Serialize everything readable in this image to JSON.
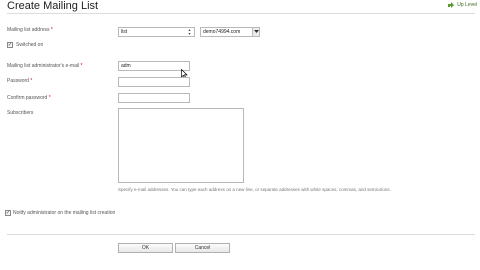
{
  "header": {
    "title": "Create Mailing List",
    "up_level": "Up Level"
  },
  "form": {
    "list_address": {
      "label": "Mailing list address",
      "req": "*",
      "value": "list",
      "domain": "demo74994.com"
    },
    "switched_on": {
      "label": "Switched on",
      "checked": true
    },
    "admin_email": {
      "label": "Mailing list administrator's e-mail",
      "req": "*",
      "value": "adm"
    },
    "password": {
      "label": "Password",
      "req": "*",
      "value": ""
    },
    "confirm_password": {
      "label": "Confirm password",
      "req": "*",
      "value": ""
    },
    "subscribers": {
      "label": "Subscribers",
      "value": "",
      "hint": "Specify e-mail addresses. You can type each address on a new line, or separate addresses with white spaces, commas, and semicolons."
    },
    "notify": {
      "label": "Notify administrator on the mailing list creation",
      "checked": true
    }
  },
  "buttons": {
    "ok": "OK",
    "cancel": "Cancel"
  }
}
